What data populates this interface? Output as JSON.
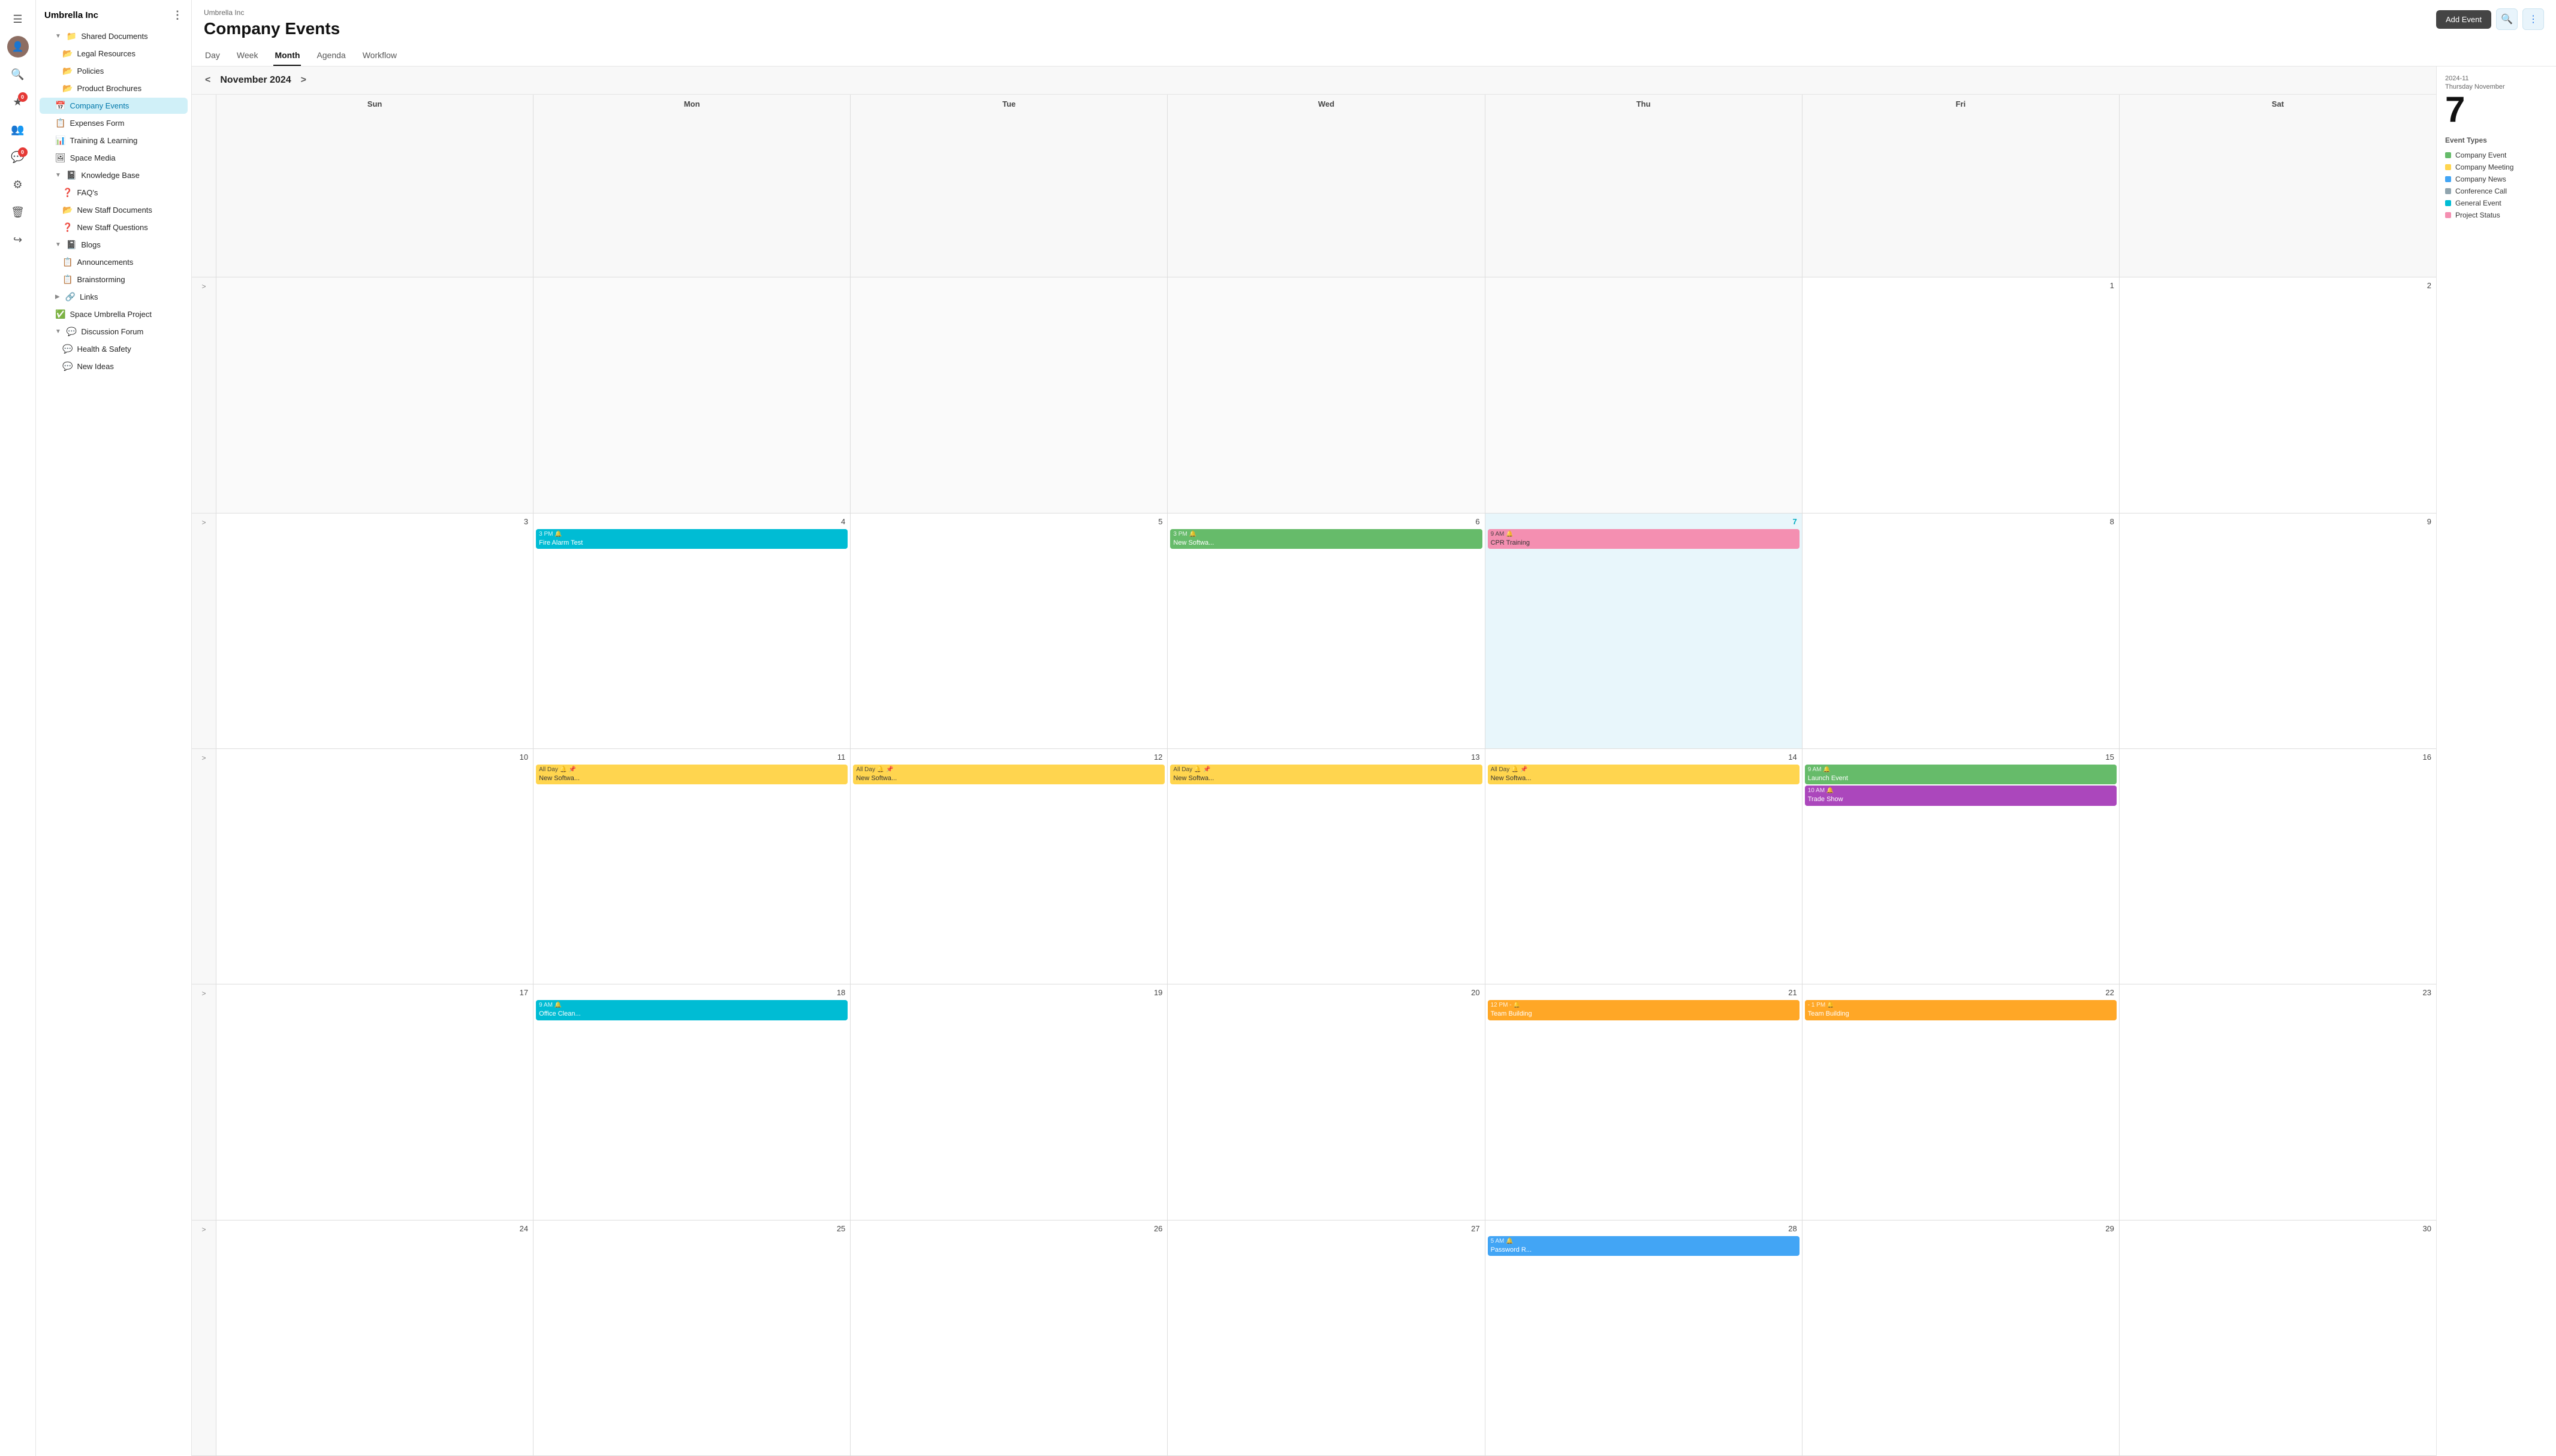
{
  "app": {
    "company": "Umbrella Inc",
    "page_title": "Company Events"
  },
  "sidebar": {
    "title": "Umbrella Inc",
    "items": [
      {
        "id": "shared-documents",
        "label": "Shared Documents",
        "icon": "📁",
        "level": 1,
        "expanded": true,
        "chevron": "▼"
      },
      {
        "id": "legal-resources",
        "label": "Legal Resources",
        "icon": "📂",
        "level": 2
      },
      {
        "id": "policies",
        "label": "Policies",
        "icon": "📂",
        "level": 2
      },
      {
        "id": "product-brochures",
        "label": "Product Brochures",
        "icon": "📂",
        "level": 2
      },
      {
        "id": "company-events",
        "label": "Company Events",
        "icon": "📅",
        "level": 1,
        "active": true
      },
      {
        "id": "expenses-form",
        "label": "Expenses Form",
        "icon": "📋",
        "level": 1
      },
      {
        "id": "training-learning",
        "label": "Training & Learning",
        "icon": "📊",
        "level": 1
      },
      {
        "id": "space-media",
        "label": "Space Media",
        "icon": "🖼",
        "level": 1
      },
      {
        "id": "knowledge-base",
        "label": "Knowledge Base",
        "icon": "📓",
        "level": 1,
        "expanded": true,
        "chevron": "▼"
      },
      {
        "id": "faqs",
        "label": "FAQ's",
        "icon": "❓",
        "level": 2
      },
      {
        "id": "new-staff-documents",
        "label": "New Staff Documents",
        "icon": "📂",
        "level": 2
      },
      {
        "id": "new-staff-questions",
        "label": "New Staff Questions",
        "icon": "❓",
        "level": 2
      },
      {
        "id": "blogs",
        "label": "Blogs",
        "icon": "📓",
        "level": 1,
        "expanded": true,
        "chevron": "▼"
      },
      {
        "id": "announcements",
        "label": "Announcements",
        "icon": "📋",
        "level": 2
      },
      {
        "id": "brainstorming",
        "label": "Brainstorming",
        "icon": "📋",
        "level": 2
      },
      {
        "id": "links",
        "label": "Links",
        "icon": "🔗",
        "level": 1,
        "chevron": "▶"
      },
      {
        "id": "space-umbrella-project",
        "label": "Space Umbrella Project",
        "icon": "✅",
        "level": 1
      },
      {
        "id": "discussion-forum",
        "label": "Discussion Forum",
        "icon": "💬",
        "level": 1,
        "expanded": true,
        "chevron": "▼"
      },
      {
        "id": "health-safety",
        "label": "Health & Safety",
        "icon": "💬",
        "level": 2
      },
      {
        "id": "new-ideas",
        "label": "New Ideas",
        "icon": "💬",
        "level": 2
      }
    ]
  },
  "icon_rail": {
    "items": [
      {
        "id": "menu",
        "icon": "☰",
        "label": "menu-icon"
      },
      {
        "id": "avatar",
        "label": "user-avatar"
      },
      {
        "id": "search",
        "icon": "🔍",
        "label": "search-icon"
      },
      {
        "id": "favorites",
        "icon": "★",
        "label": "favorites-icon",
        "badge": "0"
      },
      {
        "id": "people",
        "icon": "👥",
        "label": "people-icon"
      },
      {
        "id": "messages",
        "icon": "💬",
        "label": "messages-icon",
        "badge": "0"
      },
      {
        "id": "settings",
        "icon": "⚙",
        "label": "settings-icon"
      },
      {
        "id": "trash",
        "icon": "🗑",
        "label": "trash-icon"
      },
      {
        "id": "logout",
        "icon": "↪",
        "label": "logout-icon"
      }
    ]
  },
  "calendar": {
    "current_month": "November 2024",
    "nav_prev": "<",
    "nav_next": ">",
    "day_headers": [
      "Sun",
      "Mon",
      "Tue",
      "Wed",
      "Thu",
      "Fri",
      "Sat"
    ],
    "selected_date": "2024-11",
    "selected_day_label": "Thursday November",
    "selected_day_num": "7",
    "weeks": [
      {
        "row_indicator": ">",
        "days": [
          {
            "date": "",
            "other": true
          },
          {
            "date": "",
            "other": true
          },
          {
            "date": "",
            "other": true
          },
          {
            "date": "",
            "other": true
          },
          {
            "date": "",
            "other": true
          },
          {
            "date": "1"
          },
          {
            "date": "2"
          }
        ]
      },
      {
        "row_indicator": ">",
        "days": [
          {
            "date": "3"
          },
          {
            "date": "4",
            "events": [
              {
                "time": "3 PM",
                "title": "Fire Alarm Test",
                "color": "ev-teal",
                "icon": "🔔"
              }
            ]
          },
          {
            "date": "5"
          },
          {
            "date": "6",
            "events": [
              {
                "time": "3 PM",
                "title": "New Softwa...",
                "color": "ev-green",
                "icon": "🔔"
              }
            ]
          },
          {
            "date": "7",
            "today": true,
            "events": [
              {
                "time": "9 AM",
                "title": "CPR Training",
                "color": "ev-pink",
                "icon": "🔔"
              }
            ]
          },
          {
            "date": "8"
          },
          {
            "date": "9"
          }
        ]
      },
      {
        "row_indicator": ">",
        "days": [
          {
            "date": "10"
          },
          {
            "date": "11",
            "events": [
              {
                "time": "All Day",
                "title": "New Softwa...",
                "color": "ev-yellow",
                "icon": "🔔",
                "all_day_icon": "📌"
              }
            ]
          },
          {
            "date": "12",
            "events": [
              {
                "time": "All Day",
                "title": "New Softwa...",
                "color": "ev-yellow",
                "icon": "🔔",
                "all_day_icon": "📌"
              }
            ]
          },
          {
            "date": "13",
            "events": [
              {
                "time": "All Day",
                "title": "New Softwa...",
                "color": "ev-yellow",
                "icon": "🔔",
                "all_day_icon": "📌"
              }
            ]
          },
          {
            "date": "14",
            "events": [
              {
                "time": "All Day",
                "title": "New Softwa...",
                "color": "ev-yellow",
                "icon": "🔔",
                "all_day_icon": "📌"
              }
            ]
          },
          {
            "date": "15",
            "events": [
              {
                "time": "9 AM",
                "title": "Launch Event",
                "color": "ev-green",
                "icon": "🔔"
              },
              {
                "time": "10 AM",
                "title": "Trade Show",
                "color": "ev-purple",
                "icon": "🔔"
              }
            ]
          },
          {
            "date": "16"
          }
        ]
      },
      {
        "row_indicator": ">",
        "days": [
          {
            "date": "17"
          },
          {
            "date": "18",
            "events": [
              {
                "time": "9 AM",
                "title": "Office Clean...",
                "color": "ev-teal",
                "icon": "🔔"
              }
            ]
          },
          {
            "date": "19"
          },
          {
            "date": "20"
          },
          {
            "date": "21",
            "events": [
              {
                "time": "12 PM -",
                "title": "Team Building",
                "color": "ev-orange",
                "icon": "🔔"
              }
            ]
          },
          {
            "date": "22",
            "events": [
              {
                "time": "- 1 PM",
                "title": "Team Building",
                "color": "ev-orange",
                "icon": "🔔"
              }
            ]
          },
          {
            "date": "23"
          }
        ]
      },
      {
        "row_indicator": ">",
        "days": [
          {
            "date": "24"
          },
          {
            "date": "25"
          },
          {
            "date": "26"
          },
          {
            "date": "27"
          },
          {
            "date": "28",
            "events": [
              {
                "time": "5 AM",
                "title": "Password R...",
                "color": "ev-blue",
                "icon": "🔔"
              }
            ]
          },
          {
            "date": "29"
          },
          {
            "date": "30"
          }
        ]
      }
    ]
  },
  "tabs": {
    "items": [
      {
        "id": "day",
        "label": "Day"
      },
      {
        "id": "week",
        "label": "Week"
      },
      {
        "id": "month",
        "label": "Month",
        "active": true
      },
      {
        "id": "agenda",
        "label": "Agenda"
      },
      {
        "id": "workflow",
        "label": "Workflow"
      }
    ]
  },
  "toolbar": {
    "add_event_label": "Add Event",
    "search_label": "🔍",
    "more_label": "⋮"
  },
  "right_panel": {
    "date_label": "2024-11",
    "day_sub_label": "Thursday November",
    "day_num": "7",
    "event_types_label": "Event Types",
    "event_types": [
      {
        "id": "company-event",
        "label": "Company Event",
        "color_class": "et-company",
        "icon": "🔔"
      },
      {
        "id": "company-meeting",
        "label": "Company Meeting",
        "color_class": "et-meeting",
        "icon": "🖥"
      },
      {
        "id": "company-news",
        "label": "Company News",
        "color_class": "et-news",
        "icon": "📰"
      },
      {
        "id": "conference-call",
        "label": "Conference Call",
        "color_class": "et-conf",
        "icon": "📞"
      },
      {
        "id": "general-event",
        "label": "General Event",
        "color_class": "et-general",
        "icon": "⊙"
      },
      {
        "id": "project-status",
        "label": "Project Status",
        "color_class": "et-project",
        "icon": "⊙"
      }
    ]
  }
}
